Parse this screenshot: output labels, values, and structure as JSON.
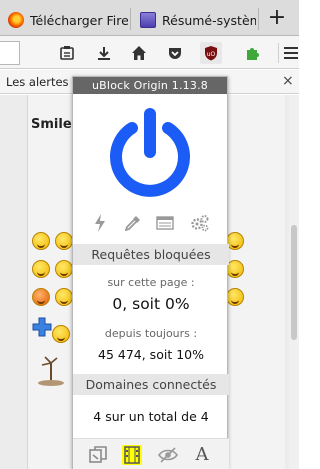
{
  "browser": {
    "tabs": [
      {
        "label": "Télécharger Firef"
      },
      {
        "label": "Résumé-système"
      }
    ],
    "new_tab_symbol": "+",
    "bookmarks_bar": {
      "item": "Les alertes e",
      "close_symbol": "×"
    },
    "toolbar_icons": [
      "reading-list-icon",
      "download-icon",
      "home-icon",
      "pocket-icon",
      "ublock-icon",
      "puzzle-icon",
      "hamburger-menu-icon"
    ]
  },
  "webpage": {
    "section_title": "Smiley"
  },
  "ublock": {
    "title": "uBlock Origin 1.13.8",
    "power_state": "on",
    "power_color": "#1a5cf5",
    "tools": [
      "lightning-icon",
      "eyedropper-icon",
      "logger-icon",
      "settings-gears-icon"
    ],
    "blocked_section": "Requêtes bloquées",
    "on_page_label": "sur cette page :",
    "on_page_value": "0, soit 0%",
    "all_time_label": "depuis toujours :",
    "all_time_value": "45 474, soit 10%",
    "domains_section": "Domaines connectés",
    "domains_value": "4 sur un total de 4",
    "footer_tools": [
      "popups-icon",
      "media-icon",
      "cosmetic-filter-eye-icon",
      "font-icon"
    ],
    "media_highlight_color": "#ffff00",
    "font_glyph": "A"
  }
}
